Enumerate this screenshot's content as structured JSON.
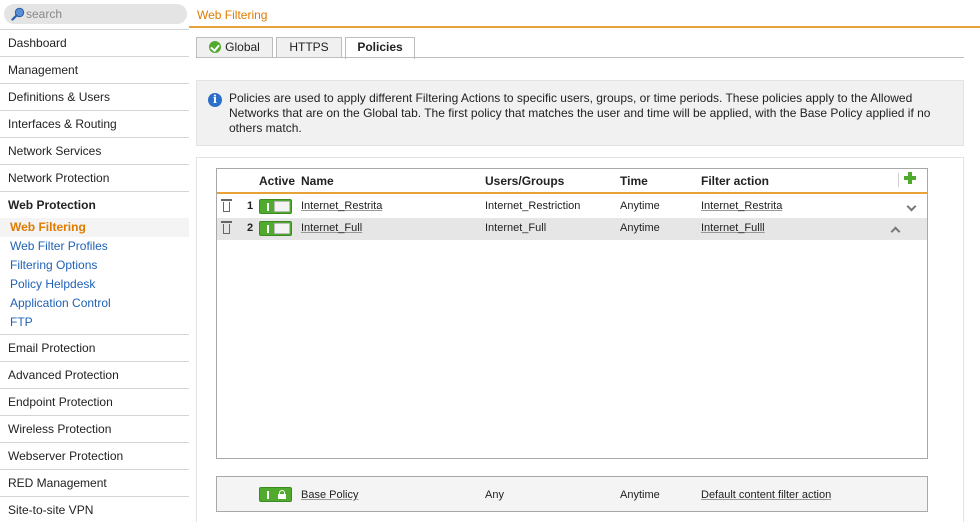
{
  "search": {
    "placeholder": "search"
  },
  "sidebar": {
    "items_before": [
      "Dashboard",
      "Management",
      "Definitions & Users",
      "Interfaces & Routing",
      "Network Services",
      "Network Protection"
    ],
    "active_group": {
      "label": "Web Protection",
      "sub_items": [
        "Web Filtering",
        "Web Filter Profiles",
        "Filtering Options",
        "Policy Helpdesk",
        "Application Control",
        "FTP"
      ],
      "active_sub": "Web Filtering"
    },
    "items_after": [
      "Email Protection",
      "Advanced Protection",
      "Endpoint Protection",
      "Wireless Protection",
      "Webserver Protection",
      "RED Management",
      "Site-to-site VPN"
    ]
  },
  "header": {
    "title": "Web Filtering"
  },
  "tabs": [
    {
      "label": "Global",
      "icon": "check-circle-icon"
    },
    {
      "label": "HTTPS"
    },
    {
      "label": "Policies",
      "active": true
    }
  ],
  "info": {
    "icon": "info-icon",
    "text": "Policies are used to apply different Filtering Actions to specific users, groups, or time periods. These policies apply to the Allowed Networks that are on the Global tab. The first policy that matches the user and time will be applied, with the Base Policy applied if no others match."
  },
  "table": {
    "columns": {
      "active": "Active",
      "name": "Name",
      "users": "Users/Groups",
      "time": "Time",
      "action": "Filter action"
    },
    "rows": [
      {
        "num": "1",
        "name": "Internet_Restrita",
        "users": "Internet_Restriction",
        "time": "Anytime",
        "action": "Internet_Restrita",
        "move": "down"
      },
      {
        "num": "2",
        "name": "Internet_Full",
        "users": "Internet_Full",
        "time": "Anytime",
        "action": "Internet_Fulll",
        "move": "up"
      }
    ]
  },
  "base_policy": {
    "name": "Base Policy",
    "users": "Any",
    "time": "Anytime",
    "action": "Default content filter action"
  },
  "colors": {
    "accent": "#e07b00",
    "toggle_on": "#4faa2e",
    "link": "#1f62b5",
    "info": "#2a6fc9"
  }
}
